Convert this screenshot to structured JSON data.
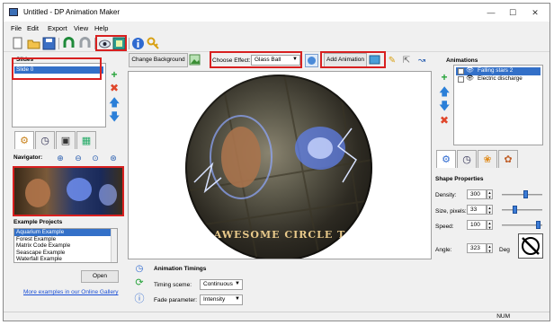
{
  "window": {
    "title": "Untitled - DP Animation Maker"
  },
  "menu": [
    "File",
    "Edit",
    "Export",
    "View",
    "Help"
  ],
  "effect_bar": {
    "change_background_label": "Change Background",
    "choose_effect_label": "Choose Effect:",
    "effect_value": "Glass Ball",
    "add_animation_label": "Add Animation"
  },
  "slides": {
    "title": "Slides",
    "items": [
      "Slide 0"
    ]
  },
  "navigator": {
    "title": "Navigator:"
  },
  "examples": {
    "title": "Example Projects",
    "items": [
      "Aquarium Example",
      "Forest Example",
      "Matrix Code Example",
      "Seascape Example",
      "Waterfall Example"
    ],
    "open_label": "Open",
    "more_link": "More examples in our Online Gallery"
  },
  "canvas": {
    "banner_text": "AWESOME CIRCLE T"
  },
  "timings": {
    "title": "Animation Timings",
    "timing_scene_label": "Timing sceme:",
    "timing_scene_value": "Continuous",
    "fade_label": "Fade parameter:",
    "fade_value": "Intensity"
  },
  "animations": {
    "title": "Animations",
    "items": [
      "Falling stars 2",
      "Electric discharge"
    ]
  },
  "shape": {
    "title": "Shape Properties",
    "density_label": "Density:",
    "density_value": "300",
    "density_level": 0.6,
    "size_label": "Size, pixels:",
    "size_value": "33",
    "size_level": 0.3,
    "speed_label": "Speed:",
    "speed_value": "100",
    "speed_level": 0.95,
    "angle_label": "Angle:",
    "angle_value": "323",
    "deg_label": "Deg"
  },
  "status": {
    "num": "NUM"
  },
  "colors": {
    "highlight": "#d82020",
    "selection": "#3370c8",
    "link": "#1a4fd6"
  }
}
